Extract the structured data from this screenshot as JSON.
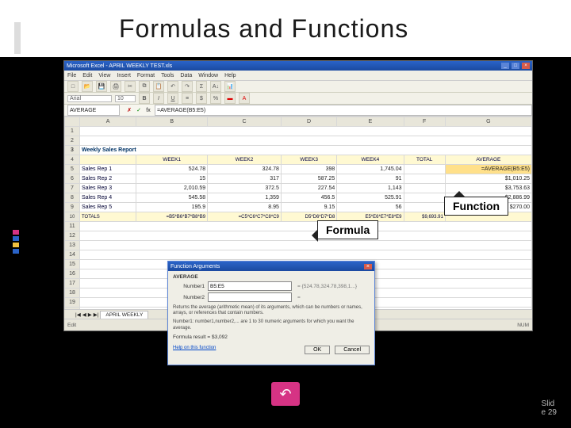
{
  "title": "Formulas and Functions",
  "callouts": {
    "formula": "Formula",
    "function": "Function"
  },
  "page_num": {
    "line1": "Slid",
    "line2": "e 29"
  },
  "excel": {
    "window_title": "Microsoft Excel - APRIL WEEKLY TEST.xls",
    "menu": [
      "File",
      "Edit",
      "View",
      "Insert",
      "Format",
      "Tools",
      "Data",
      "Window",
      "Help"
    ],
    "name_box": "AVERAGE",
    "formula_bar": "=AVERAGE(B5:E5)",
    "cols": [
      "A",
      "B",
      "C",
      "D",
      "E",
      "F",
      "G"
    ],
    "report_title": "Weekly Sales Report",
    "headers": [
      "",
      "WEEK1",
      "WEEK2",
      "WEEK3",
      "WEEK4",
      "TOTAL",
      "AVERAGE"
    ],
    "rows": [
      {
        "label": "Sales Rep 1",
        "v": [
          "524.78",
          "324.78",
          "398",
          "1,745.04",
          "",
          "=AVERAGE(B5:E5)"
        ]
      },
      {
        "label": "Sales Rep 2",
        "v": [
          "15",
          "317",
          "587.25",
          "91",
          "",
          "$1,010.25"
        ]
      },
      {
        "label": "Sales Rep 3",
        "v": [
          "2,010.59",
          "372.5",
          "227.54",
          "1,143",
          "",
          "$3,753.63"
        ]
      },
      {
        "label": "Sales Rep 4",
        "v": [
          "545.58",
          "1,359",
          "456.5",
          "525.91",
          "",
          "$2,886.99"
        ]
      },
      {
        "label": "Sales Rep 5",
        "v": [
          "195.9",
          "8.95",
          "9.15",
          "56",
          "",
          "$270.00"
        ]
      }
    ],
    "totals": {
      "label": "TOTALS",
      "v": [
        "=B5*B6*B7*B8*B9",
        "=C5*C6*C7*C8*C9",
        "D5*D6*D7*D8",
        "E5*E6*E7*E8*E9",
        "$9,693.91"
      ]
    },
    "sheet_tab": "APRIL WEEKLY",
    "status_left": "Edit",
    "status_right": "NUM"
  },
  "dialog": {
    "title": "Function Arguments",
    "fn": "AVERAGE",
    "number1_label": "Number1",
    "number1_value": "B5:E5",
    "number1_eval": "= {524.78,324.78,398,1...}",
    "number2_label": "Number2",
    "desc_main": "Returns the average (arithmetic mean) of its arguments, which can be numbers or names, arrays, or references that contain numbers.",
    "desc_arg": "Number1: number1,number2,... are 1 to 30 numeric arguments for which you want the average.",
    "result_label": "Formula result =",
    "result_value": "$3,092",
    "help": "Help on this function",
    "ok": "OK",
    "cancel": "Cancel"
  }
}
